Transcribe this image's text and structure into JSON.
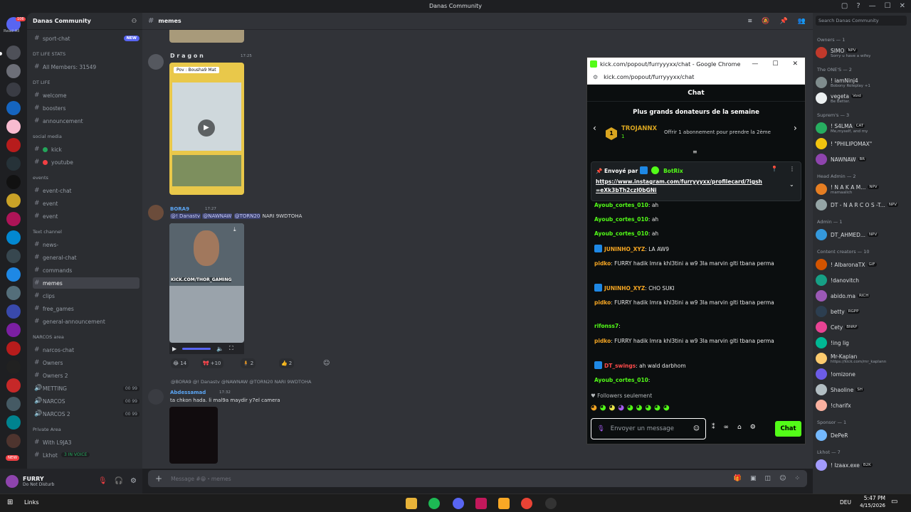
{
  "window": {
    "title": "Danas Community"
  },
  "server_rail": {
    "read_all": "Read All",
    "badge_count": "106",
    "new_label": "NEW"
  },
  "sidebar": {
    "guild_name": "Danas Community",
    "items": [
      {
        "label": "sport-chat",
        "kind": "channel",
        "badge": "NEW"
      },
      {
        "label": "DT LIFE STATS",
        "kind": "category"
      },
      {
        "label": "All Members: 31549",
        "kind": "channel"
      },
      {
        "label": "DT LIFE",
        "kind": "category"
      },
      {
        "label": "welcome",
        "kind": "channel"
      },
      {
        "label": "boosters",
        "kind": "channel"
      },
      {
        "label": "announcement",
        "kind": "channel"
      },
      {
        "label": "social media",
        "kind": "category"
      },
      {
        "label": "kick",
        "kind": "channel",
        "dot": "#23a55a"
      },
      {
        "label": "youtube",
        "kind": "channel",
        "dot": "#f23f43"
      },
      {
        "label": "events",
        "kind": "category"
      },
      {
        "label": "event-chat",
        "kind": "channel"
      },
      {
        "label": "event",
        "kind": "channel"
      },
      {
        "label": "event",
        "kind": "channel"
      },
      {
        "label": "Text channel",
        "kind": "category"
      },
      {
        "label": "news-",
        "kind": "channel"
      },
      {
        "label": "general-chat",
        "kind": "channel"
      },
      {
        "label": "commands",
        "kind": "channel"
      },
      {
        "label": "memes",
        "kind": "channel",
        "active": true
      },
      {
        "label": "clips",
        "kind": "channel"
      },
      {
        "label": "free_games",
        "kind": "channel"
      },
      {
        "label": "general-announcement",
        "kind": "channel"
      },
      {
        "label": "NARCOS area",
        "kind": "category"
      },
      {
        "label": "narcos-chat",
        "kind": "channel"
      },
      {
        "label": "Owners",
        "kind": "channel"
      },
      {
        "label": "Owners 2",
        "kind": "channel"
      },
      {
        "label": "METTING",
        "kind": "voice",
        "count": "00 99"
      },
      {
        "label": "NARCOS",
        "kind": "voice",
        "count": "00 99"
      },
      {
        "label": "NARCOS 2",
        "kind": "voice",
        "count": "00 99"
      },
      {
        "label": "Private Area",
        "kind": "category"
      },
      {
        "label": "With L9JA3",
        "kind": "channel"
      },
      {
        "label": "Lkhot",
        "kind": "channel"
      }
    ],
    "voice_badge": "3 IN VOICE"
  },
  "user_panel": {
    "name": "FURRY",
    "status": "Do Not Disturb"
  },
  "chat": {
    "channel": "memes",
    "input_placeholder": "Message #😁・memes",
    "messages": [
      {
        "author": "D r a g o n",
        "time": "17:25",
        "video_caption": "Pov : Bousha9 Mat"
      },
      {
        "author": "BORA9",
        "time": "17:27",
        "text": "NARI 9WDTOHA",
        "mentions": [
          "@! Danastv",
          "@NAWNAW",
          "@TORN20"
        ],
        "video_caption": "KICK.COM/THOR_GAMING",
        "reactions": [
          "14",
          "+10",
          "2",
          "2"
        ]
      },
      {
        "author": "Abdessamad",
        "time": "17:32",
        "reply": "@BORA9  @! Danastv  @NAWNAW  @TORN20  NARI 9WDTOHA",
        "text": "ta chkon hada. li mal9a maydir y7el camera"
      }
    ]
  },
  "kick_popup": {
    "window_title": "kick.com/popout/furryyyxx/chat - Google Chrome",
    "address": "kick.com/popout/furryyyxx/chat",
    "chat_title": "Chat",
    "donors_title": "Plus grands donateurs de la semaine",
    "top_donor": "TROJANNX",
    "top_donor_amount": "1",
    "rank": "1",
    "offer_text": "Offrir 1 abonnement pour prendre la 2ème",
    "pinned_by": "Envoyé par",
    "pinned_user": "BotRix",
    "pinned_link": "https://www.instagram.com/furryyyxx/profilecard/?igsh=eXk3bTh2czI0bGNi",
    "messages": [
      {
        "user": "Ayoub_cortes_010",
        "text": "ah",
        "color": "green"
      },
      {
        "user": "Ayoub_cortes_010",
        "text": "ah",
        "color": "green"
      },
      {
        "user": "Ayoub_cortes_010",
        "text": "ah",
        "color": "green"
      },
      {
        "user": "JUNINHO_XYZ",
        "text": "LA AW9",
        "color": "orange"
      },
      {
        "user": "pidko",
        "text": "FURRY hadik lmra khl3tini a w9 3la marvin glti tbana perma",
        "color": "orange"
      },
      {
        "user": "JUNINHO_XYZ",
        "text": "CHO SUKI",
        "color": "orange"
      },
      {
        "user": "pidko",
        "text": "FURRY hadik lmra khl3tini a w9 3la marvin glti tbana perma",
        "color": "orange"
      },
      {
        "user": "rifonss7",
        "text": "",
        "color": "green"
      },
      {
        "user": "pidko",
        "text": "FURRY hadik lmra khl3tini a w9 3la marvin glti tbana perma",
        "color": "orange"
      },
      {
        "user": "DT_swings",
        "text": "ah wald darbhom",
        "color": "red"
      },
      {
        "user": "Ayoub_cortes_010",
        "text": "",
        "color": "green"
      }
    ],
    "followers_only": "Followers seulement",
    "input_placeholder": "Envoyer un message",
    "send_label": "Chat"
  },
  "members": {
    "search_placeholder": "Search Danas Community",
    "groups": [
      {
        "title": "Owners — 1",
        "members": [
          {
            "name": "SIMO",
            "tag": "NPV",
            "sub": "Sorry u have a wifey"
          }
        ]
      },
      {
        "title": "The ONE'S — 2",
        "members": [
          {
            "name": "! iamNinj4",
            "sub": "Bobony Roleplay +1"
          },
          {
            "name": "vegeta",
            "tag": "Void",
            "sub": "Be Better."
          }
        ]
      },
      {
        "title": "Suprem's — 3",
        "members": [
          {
            "name": "! S4LMA",
            "tag": "CAT",
            "sub": "Me,myself, and my"
          },
          {
            "name": "! \"PHILIPOMAX\""
          },
          {
            "name": "NAWNAW",
            "tag": "BR"
          }
        ]
      },
      {
        "title": "Head Admin — 2",
        "members": [
          {
            "name": "! N A K A M...",
            "tag": "NPV",
            "sub": "mamaalich"
          },
          {
            "name": "DT - N A R C O S -T...",
            "tag": "NPV"
          }
        ]
      },
      {
        "title": "Admin — 1",
        "members": [
          {
            "name": "DT_AHMED...",
            "tag": "NPV"
          }
        ]
      },
      {
        "title": "Content creators — 10",
        "members": [
          {
            "name": "! AlbaronaTX",
            "tag": "GIF"
          },
          {
            "name": "!danovitch"
          },
          {
            "name": "abido.ma",
            "tag": "RICH"
          },
          {
            "name": "betty",
            "tag": "RGPP"
          },
          {
            "name": "Cety",
            "tag": "BNRP"
          },
          {
            "name": "!ing lig"
          },
          {
            "name": "Mr-Kaplan",
            "sub": "https://kick.com/mr_kaplann"
          },
          {
            "name": "!omizone"
          },
          {
            "name": "Shaoline",
            "tag": "SH"
          },
          {
            "name": "!charifx"
          }
        ]
      },
      {
        "title": "Sponsor — 1",
        "members": [
          {
            "name": "DePeR"
          }
        ]
      },
      {
        "title": "Lkhot — 7",
        "members": [
          {
            "name": "! Izaax.exe",
            "tag": "B2K"
          }
        ]
      }
    ]
  },
  "taskbar": {
    "left_label": "Links",
    "lang": "DEU",
    "time": "5:47 PM",
    "date": "4/15/2026"
  },
  "colors": {
    "discord_bg": "#313338",
    "kick_green": "#53fc18",
    "blurple": "#5865f2"
  },
  "icons": [
    "search-icon",
    "pin-icon",
    "gear-icon",
    "play-icon",
    "chevron-left-icon",
    "chevron-right-icon",
    "emoji-icon",
    "windows-icon"
  ]
}
